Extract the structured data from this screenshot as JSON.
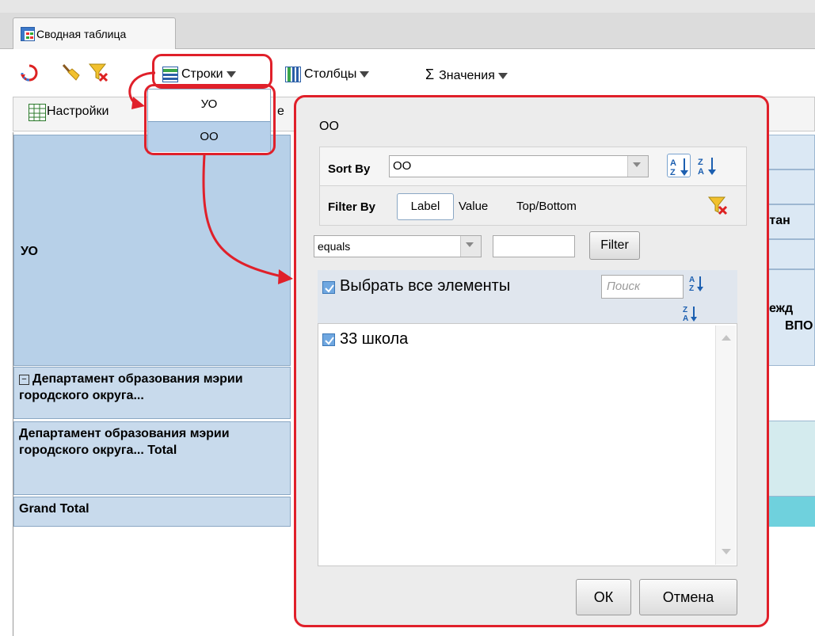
{
  "tab": {
    "label": "Сводная таблица"
  },
  "toolbar": {
    "rows_label": "Строки",
    "columns_label": "Столбцы",
    "values_label": "Значения",
    "values_symbol": "Σ"
  },
  "toolbar2": {
    "settings_label": "Настройки",
    "partial_label": "е"
  },
  "grid": {
    "row_header": "УО",
    "row1_text": "Департамент образования мэрии городского округа...",
    "row2_text": "Департамент образования мэрии городского округа... Total",
    "grand_total": "Grand Total",
    "right_fragment_1": "спитан",
    "right_fragment_2": "учрежд",
    "right_fragment_3": "ВПО"
  },
  "dropdown": {
    "items": [
      "УО",
      "ОО"
    ],
    "selected": "ОО"
  },
  "dialog": {
    "title": "ОО",
    "sort_by_label": "Sort By",
    "sort_by_value": "ОО",
    "filter_by_label": "Filter By",
    "filter_tabs": [
      "Label",
      "Value",
      "Top/Bottom"
    ],
    "condition_value": "equals",
    "filter_input_value": "",
    "filter_button": "Filter",
    "select_all_label": "Выбрать все элементы",
    "search_placeholder": "Поиск",
    "list_items": [
      {
        "label": "33 школа",
        "checked": true
      }
    ],
    "ok_button": "ОК",
    "cancel_button": "Отмена"
  },
  "colors": {
    "accent_red": "#e0202a",
    "header_blue": "#b7d0e8",
    "row_blue": "#c8daec"
  }
}
